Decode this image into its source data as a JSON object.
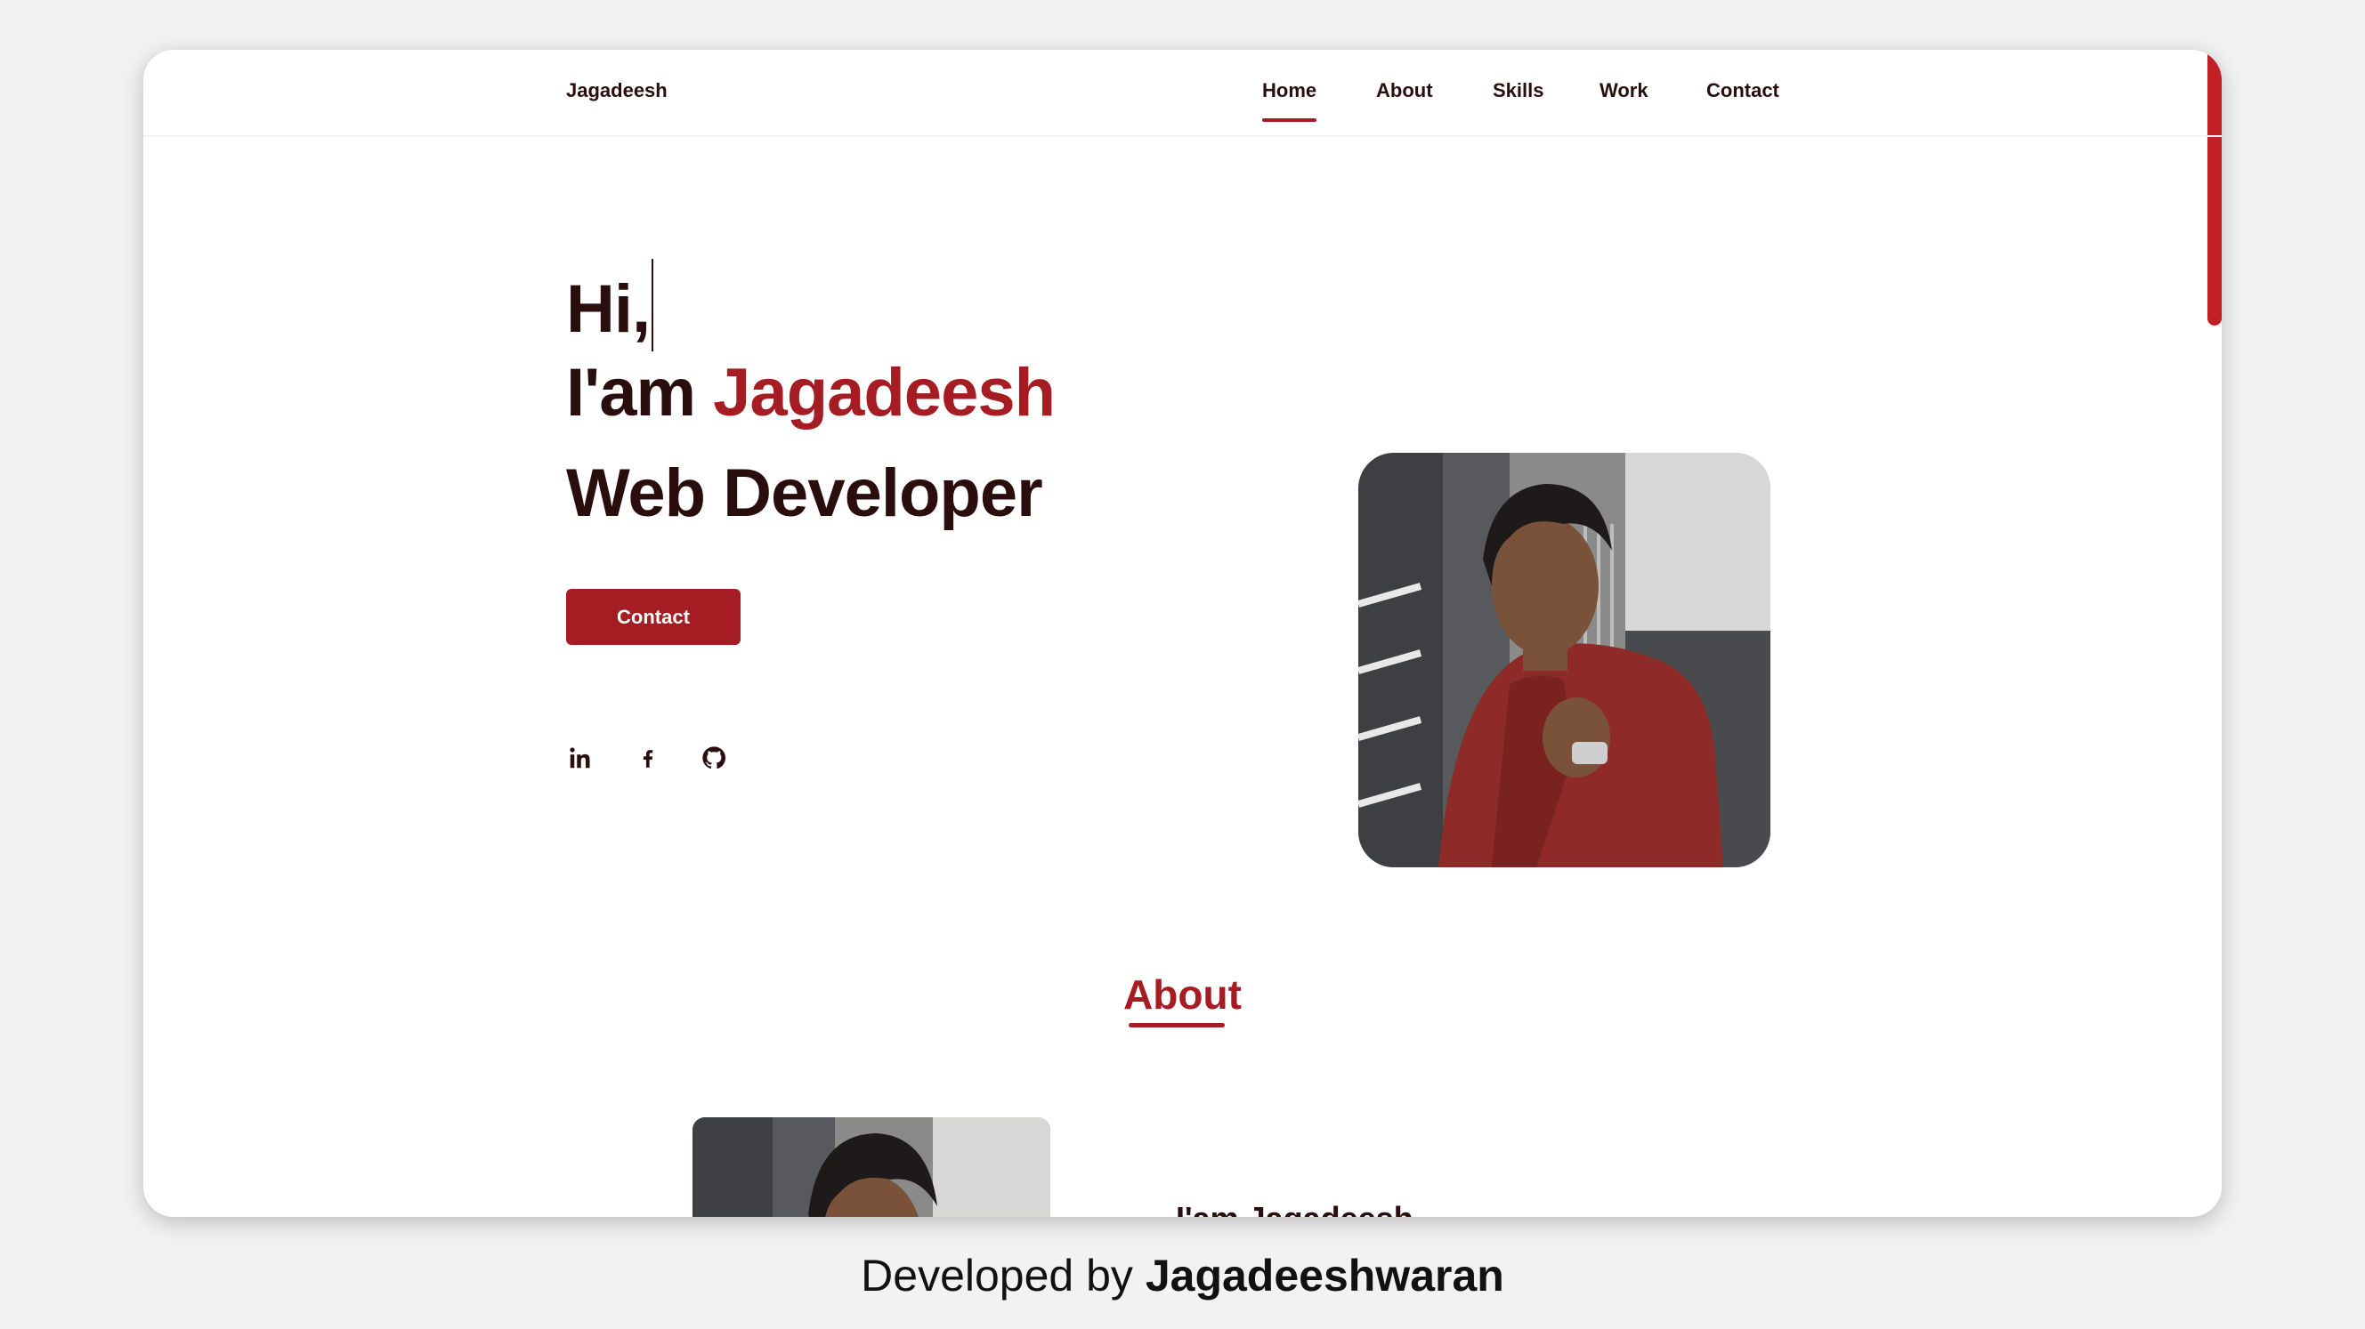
{
  "nav": {
    "brand": "Jagadeesh",
    "items": [
      {
        "label": "Home",
        "active": true
      },
      {
        "label": "About",
        "active": false
      },
      {
        "label": "Skills",
        "active": false
      },
      {
        "label": "Work",
        "active": false
      },
      {
        "label": "Contact",
        "active": false
      }
    ]
  },
  "hero": {
    "greeting": "Hi,",
    "intro_prefix": "I'am ",
    "name": "Jagadeesh",
    "role": "Web Developer",
    "contact_button": "Contact",
    "socials": [
      "linkedin-icon",
      "facebook-icon",
      "github-icon"
    ]
  },
  "about": {
    "title": "About",
    "name_heading": "I'am Jagadeesh"
  },
  "footer": {
    "prefix": "Developed by ",
    "author": "Jagadeeshwaran"
  },
  "colors": {
    "accent": "#a51c23",
    "text": "#2a0e0e",
    "page_bg": "#f2f2f2"
  }
}
